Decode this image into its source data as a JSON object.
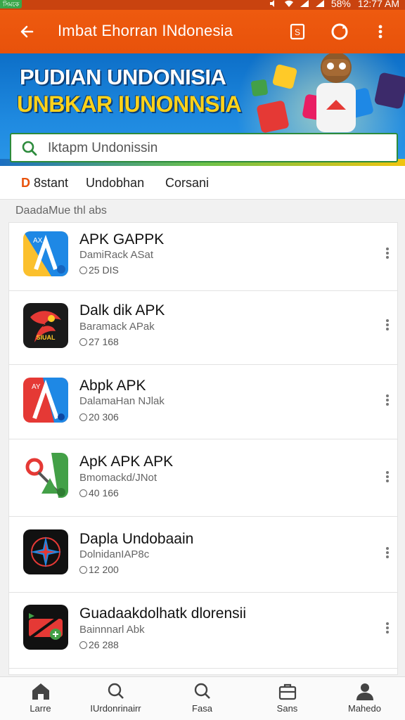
{
  "status": {
    "badge": "সিমকে",
    "battery": "58%",
    "time": "12:77 AM"
  },
  "app_bar": {
    "title": "Imbat Ehorran INdonesia",
    "icons": [
      "back-arrow-icon",
      "app-share-icon",
      "refresh-icon",
      "more-vert-icon"
    ]
  },
  "banner": {
    "line1": "PUDIAN UNDONISIA",
    "line2": "UNBKAR IUNONNSIA",
    "colors": {
      "bg": "#1f8ae0",
      "line1": "#ffffff",
      "line2": "#ffd21a"
    }
  },
  "search": {
    "placeholder": "Iktapm Undonissin"
  },
  "tabs": [
    {
      "first_letter": "D",
      "rest": " 8stant"
    },
    {
      "label": "Undobhan"
    },
    {
      "label": "Corsani"
    }
  ],
  "section_title": "DaadaMue thl abs",
  "apps": [
    {
      "name": "APK GAPPK",
      "developer": "DamiRack ASat",
      "downloads": "25 DIS",
      "icon": "yellow-blue-a-icon"
    },
    {
      "name": "Dalk dik APK",
      "developer": "Baramack APak",
      "downloads": "27 168",
      "icon": "dragon-game-icon"
    },
    {
      "name": "Abpk APK",
      "developer": "DalamaHan NJlak",
      "downloads": "20 306",
      "icon": "red-blue-a-icon"
    },
    {
      "name": "ApK APK APK",
      "developer": "Bmomackd/JNot",
      "downloads": "40 166",
      "icon": "search-arrow-icon"
    },
    {
      "name": "Dapla Undobaain",
      "developer": "DolnidanIAP8c",
      "downloads": "12 200",
      "icon": "compass-star-icon"
    },
    {
      "name": "Guadaakdolhatk dlorensii",
      "developer": "Bainnnarl Abk",
      "downloads": "26 288",
      "icon": "green-red-badge-icon"
    }
  ],
  "bottom_nav": [
    {
      "label": "Larre",
      "icon": "home-icon"
    },
    {
      "label": "IUrdonrinairr",
      "icon": "search-icon"
    },
    {
      "label": "Fasa",
      "icon": "search-icon"
    },
    {
      "label": "Sans",
      "icon": "briefcase-icon"
    },
    {
      "label": "Mahedo",
      "icon": "person-icon"
    }
  ],
  "colors": {
    "primary": "#e8520b",
    "search_border": "#2d8b3c"
  }
}
